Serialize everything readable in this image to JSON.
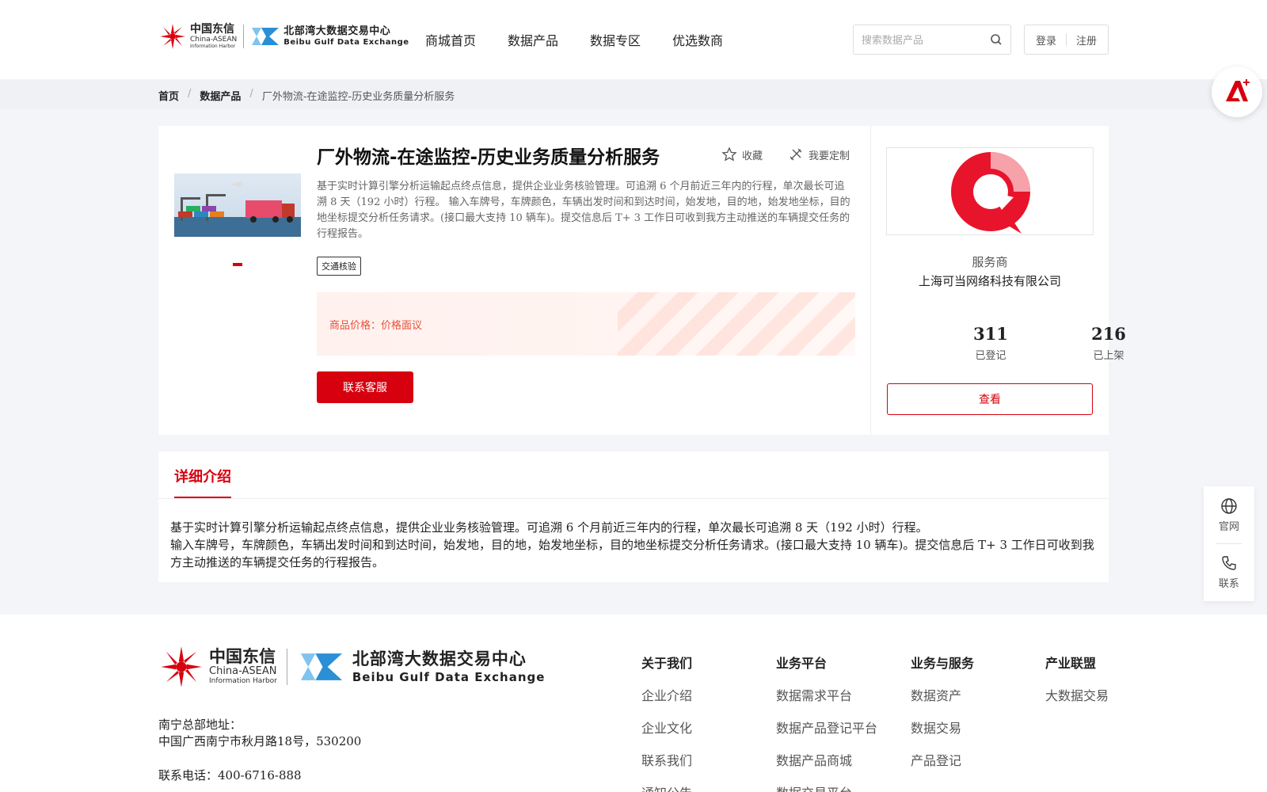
{
  "header": {
    "logo_cn": {
      "line1": "中国东信",
      "line2": "China-ASEAN",
      "line3": "Information Harbor"
    },
    "logo_bb": {
      "line1": "北部湾大数据交易中心",
      "line2": "Beibu Gulf Data Exchange"
    },
    "nav": [
      "商城首页",
      "数据产品",
      "数据专区",
      "优选数商"
    ],
    "search_placeholder": "搜索数据产品",
    "login": "登录",
    "register": "注册"
  },
  "breadcrumb": {
    "home": "首页",
    "section": "数据产品",
    "current": "厂外物流-在途监控-历史业务质量分析服务"
  },
  "product": {
    "title": "厂外物流-在途监控-历史业务质量分析服务",
    "favorite": "收藏",
    "customize": "我要定制",
    "description": "基于实时计算引擎分析运输起点终点信息，提供企业业务核验管理。可追溯 6 个月前近三年内的行程，单次最长可追溯 8 天（192 小时）行程。 输入车牌号，车牌颜色，车辆出发时间和到达时间，始发地，目的地，始发地坐标，目的地坐标提交分析任务请求。(接口最大支持 10 辆车)。提交信息后 T+ 3 工作日可收到我方主动推送的车辆提交任务的行程报告。",
    "tag": "交通核验",
    "price_label": "商品价格：",
    "price_value": "价格面议",
    "contact_button": "联系客服"
  },
  "provider": {
    "label": "服务商",
    "name": "上海可当网络科技有限公司",
    "registered_count": "311",
    "registered_label": "已登记",
    "listed_count": "216",
    "listed_label": "已上架",
    "view_button": "查看"
  },
  "details": {
    "tab": "详细介绍",
    "line1": "基于实时计算引擎分析运输起点终点信息，提供企业业务核验管理。可追溯 6 个月前近三年内的行程，单次最长可追溯 8 天（192 小时）行程。",
    "line2": "输入车牌号，车牌颜色，车辆出发时间和到达时间，始发地，目的地，始发地坐标，目的地坐标提交分析任务请求。(接口最大支持 10 辆车)。提交信息后 T+ 3 工作日可收到我方主动推送的车辆提交任务的行程报告。"
  },
  "side_tools": {
    "website": "官网",
    "contact": "联系"
  },
  "footer": {
    "address_label": "南宁总部地址：",
    "address": "中国广西南宁市秋月路18号，530200",
    "phone": "联系电话：400-6716-888",
    "columns": [
      {
        "title": "关于我们",
        "links": [
          "企业介绍",
          "企业文化",
          "联系我们",
          "通知公告"
        ]
      },
      {
        "title": "业务平台",
        "links": [
          "数据需求平台",
          "数据产品登记平台",
          "数据产品商城",
          "数据交易平台"
        ]
      },
      {
        "title": "业务与服务",
        "links": [
          "数据资产",
          "数据交易",
          "产品登记"
        ]
      },
      {
        "title": "产业联盟",
        "links": [
          "大数据交易"
        ]
      }
    ]
  },
  "colors": {
    "brand_red": "#d7000f",
    "price_orange": "#e8503a",
    "logo_blue": "#2a8fd6"
  }
}
